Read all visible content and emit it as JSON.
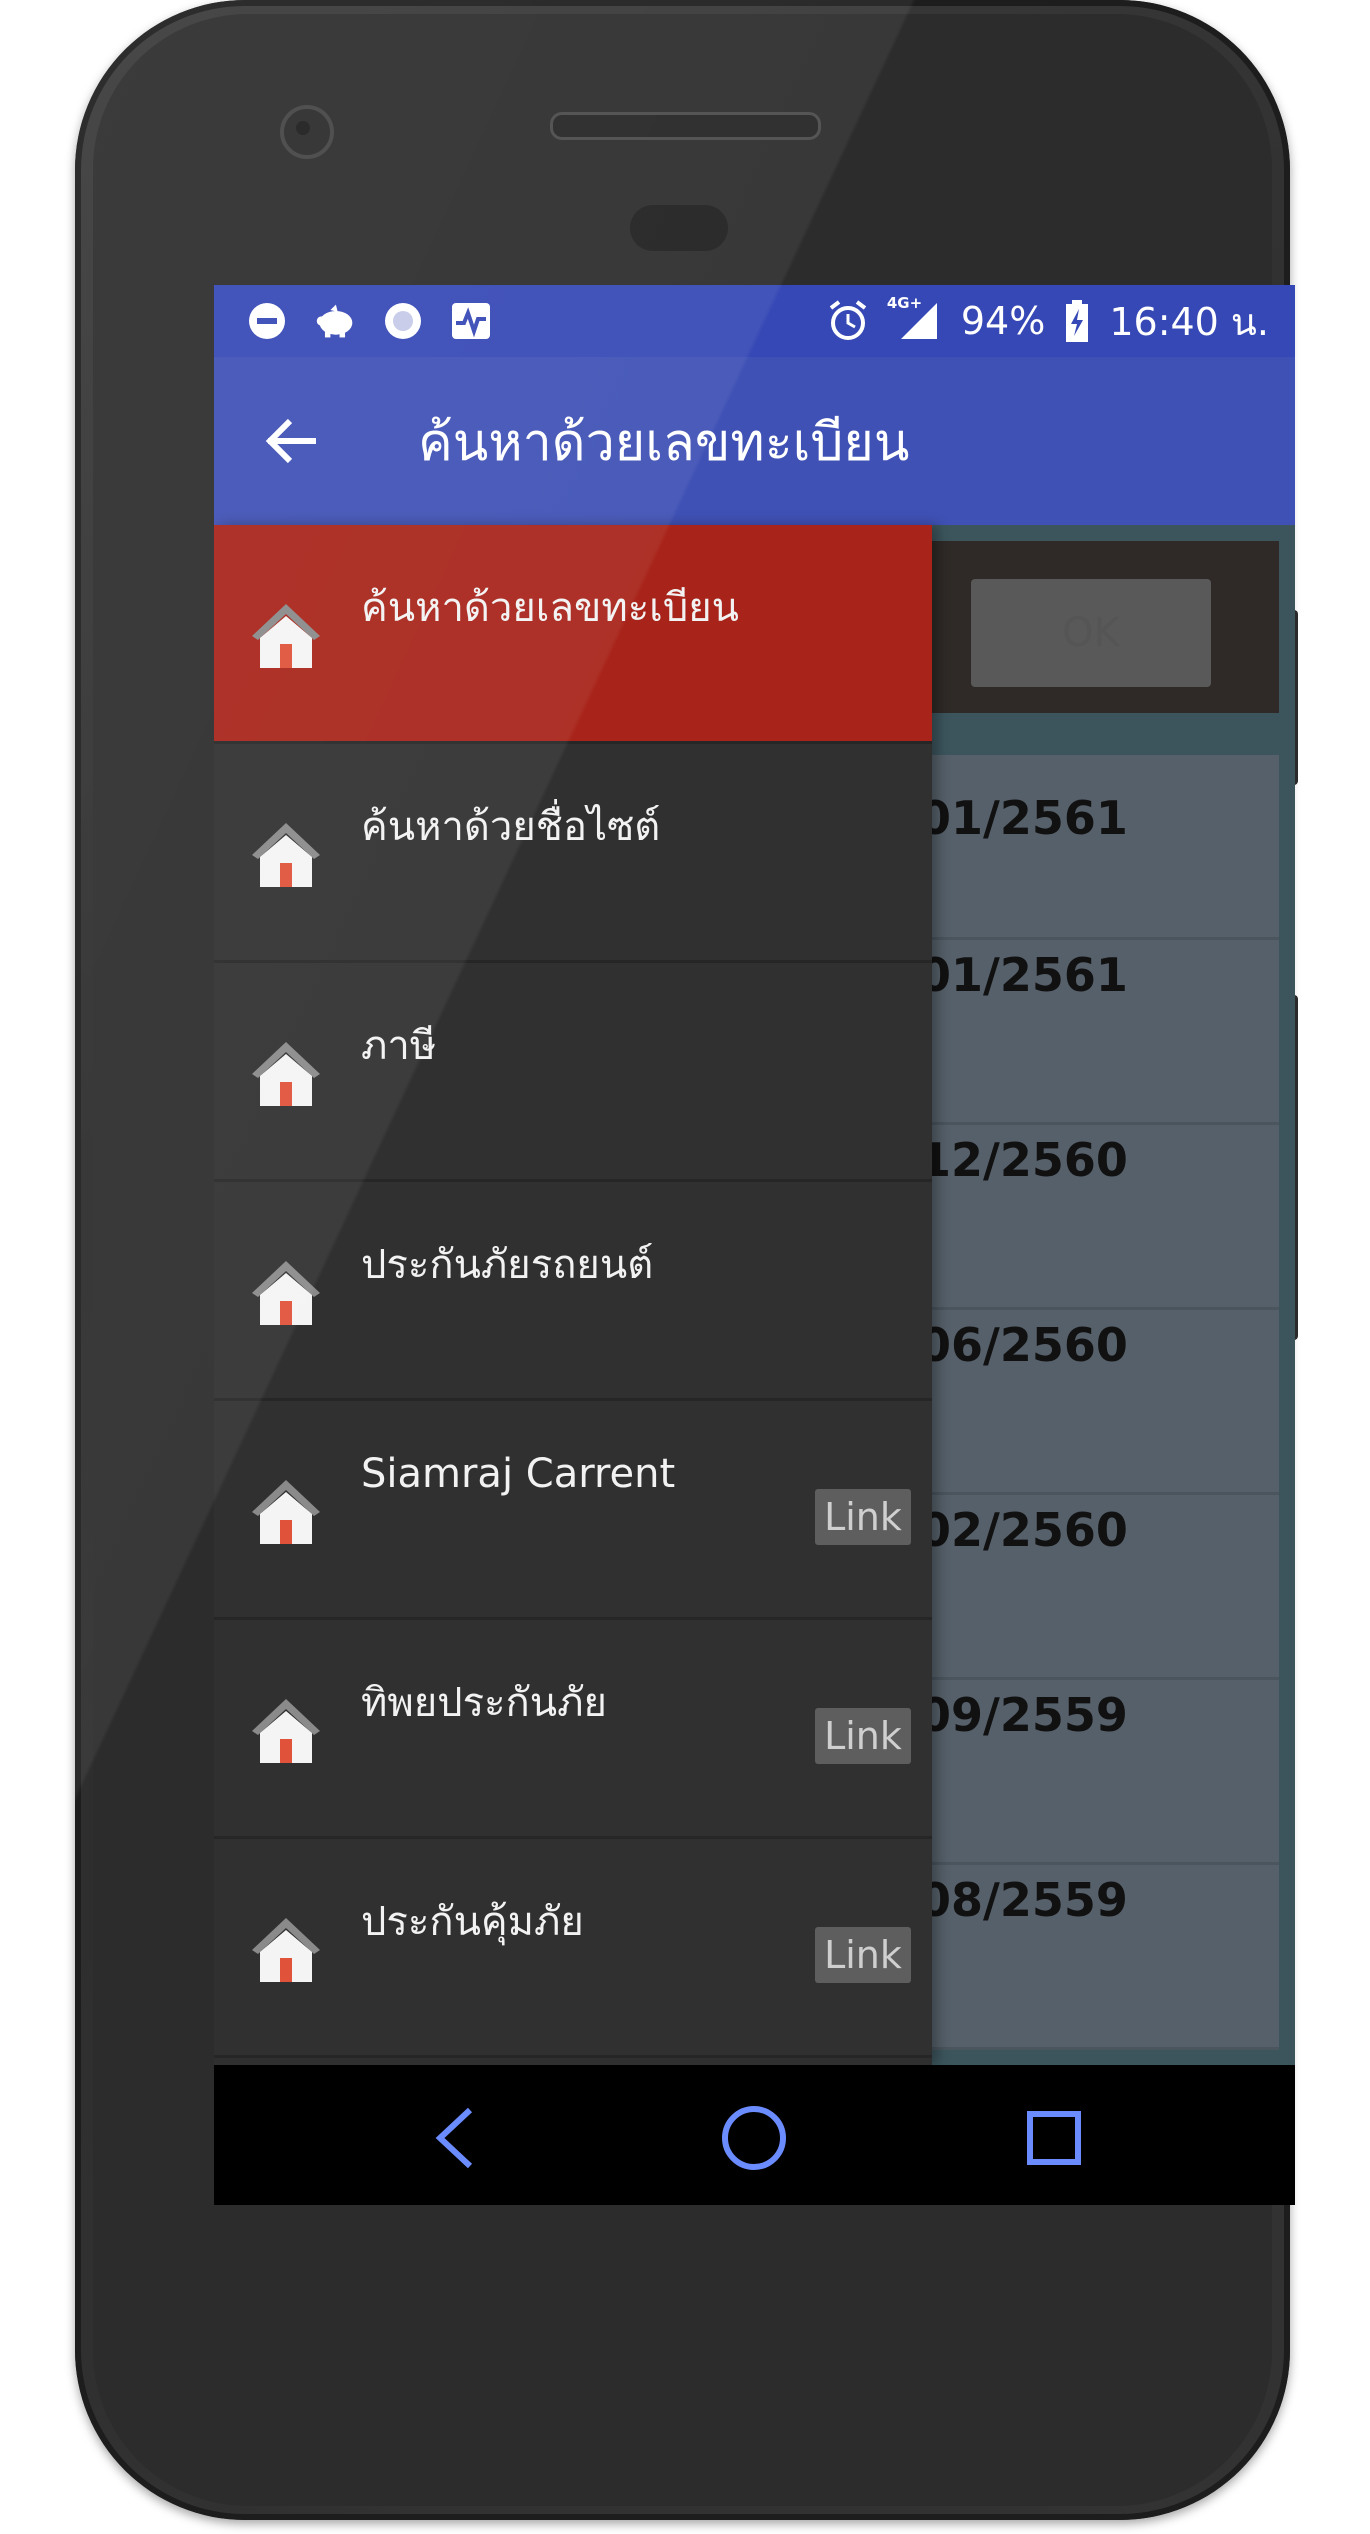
{
  "statusbar": {
    "battery": "94%",
    "time": "16:40 น.",
    "network": "4G+",
    "icons": [
      "do-not-disturb-icon",
      "piggy-bank-icon",
      "circle-app-icon",
      "activity-monitor-icon",
      "alarm-icon",
      "signal-icon",
      "battery-charging-icon"
    ]
  },
  "appbar": {
    "title": "ค้นหาด้วยเลขทะเบียน"
  },
  "search": {
    "ok_label": "OK"
  },
  "results": [
    {
      "date": "01/2561"
    },
    {
      "date": "01/2561"
    },
    {
      "date": "12/2560"
    },
    {
      "date": "06/2560"
    },
    {
      "date": "02/2560"
    },
    {
      "date": "09/2559"
    },
    {
      "date": "08/2559"
    }
  ],
  "drawer": {
    "items": [
      {
        "label": "ค้นหาด้วยเลขทะเบียน",
        "link": ""
      },
      {
        "label": "ค้นหาด้วยชื่อไซต์",
        "link": ""
      },
      {
        "label": "ภาษี",
        "link": ""
      },
      {
        "label": "ประกันภัยรถยนต์",
        "link": ""
      },
      {
        "label": "Siamraj Carrent",
        "link": "Link"
      },
      {
        "label": "ทิพยประกันภัย",
        "link": "Link"
      },
      {
        "label": "ประกันคุ้มภัย",
        "link": "Link"
      }
    ]
  },
  "colors": {
    "statusbar": "#3648b5",
    "appbar": "#3f51b5",
    "drawer_active": "#a8241a",
    "drawer_bg": "#303030"
  }
}
